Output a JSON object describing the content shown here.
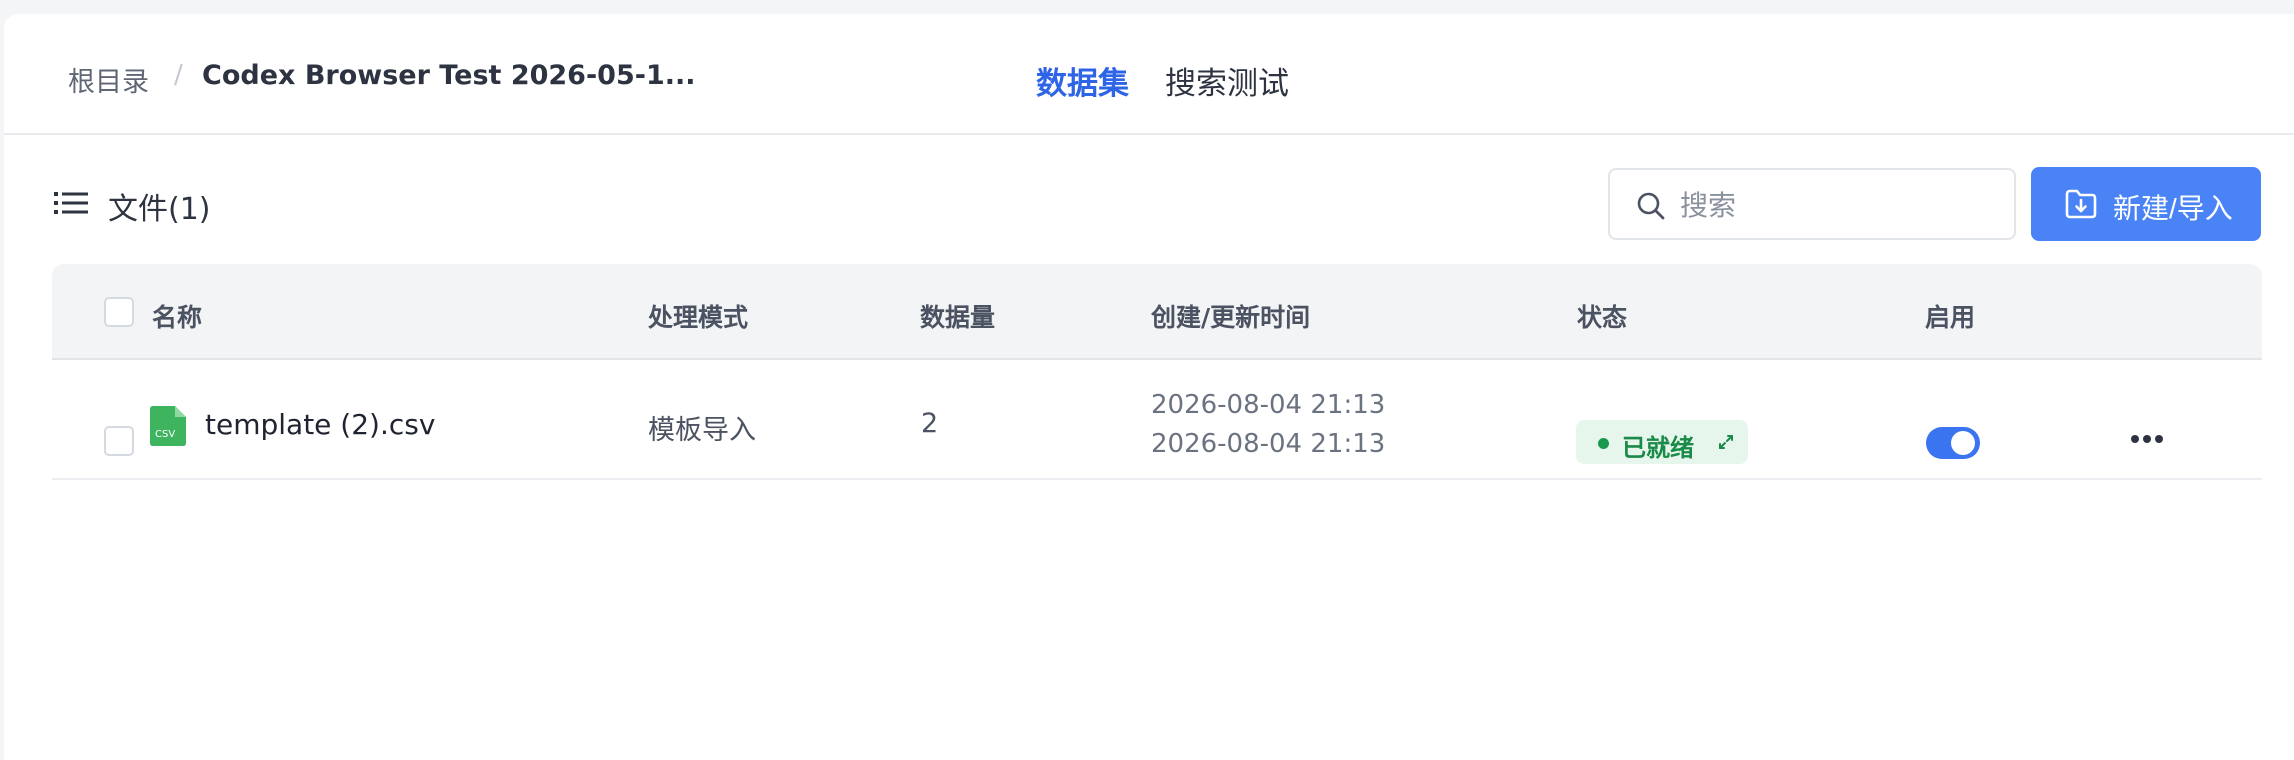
{
  "breadcrumb": {
    "root": "根目录",
    "separator": "/",
    "current": "Codex Browser Test 2026-05-1..."
  },
  "tabs": {
    "dataset": "数据集",
    "search_test": "搜索测试",
    "active": "dataset"
  },
  "toolbar": {
    "files_title": "文件(1)",
    "search_placeholder": "搜索",
    "new_import_label": "新建/导入"
  },
  "table": {
    "columns": {
      "name": "名称",
      "mode": "处理模式",
      "count": "数据量",
      "time": "创建/更新时间",
      "status": "状态",
      "enabled": "启用"
    },
    "rows": [
      {
        "name": "template (2).csv",
        "file_type": "CSV",
        "mode": "模板导入",
        "count": "2",
        "created": "2026-08-04 21:13",
        "updated": "2026-08-04 21:13",
        "status": "已就绪",
        "enabled": true
      }
    ]
  },
  "colors": {
    "accent": "#2e64e6",
    "button": "#4a83f6",
    "status_green": "#1a8a48",
    "status_bg": "#e7f6ec",
    "csv_green": "#3fb45e"
  },
  "icons": [
    "list-icon",
    "search-icon",
    "folder-import-icon",
    "csv-file-icon",
    "expand-icon",
    "more-icon"
  ]
}
